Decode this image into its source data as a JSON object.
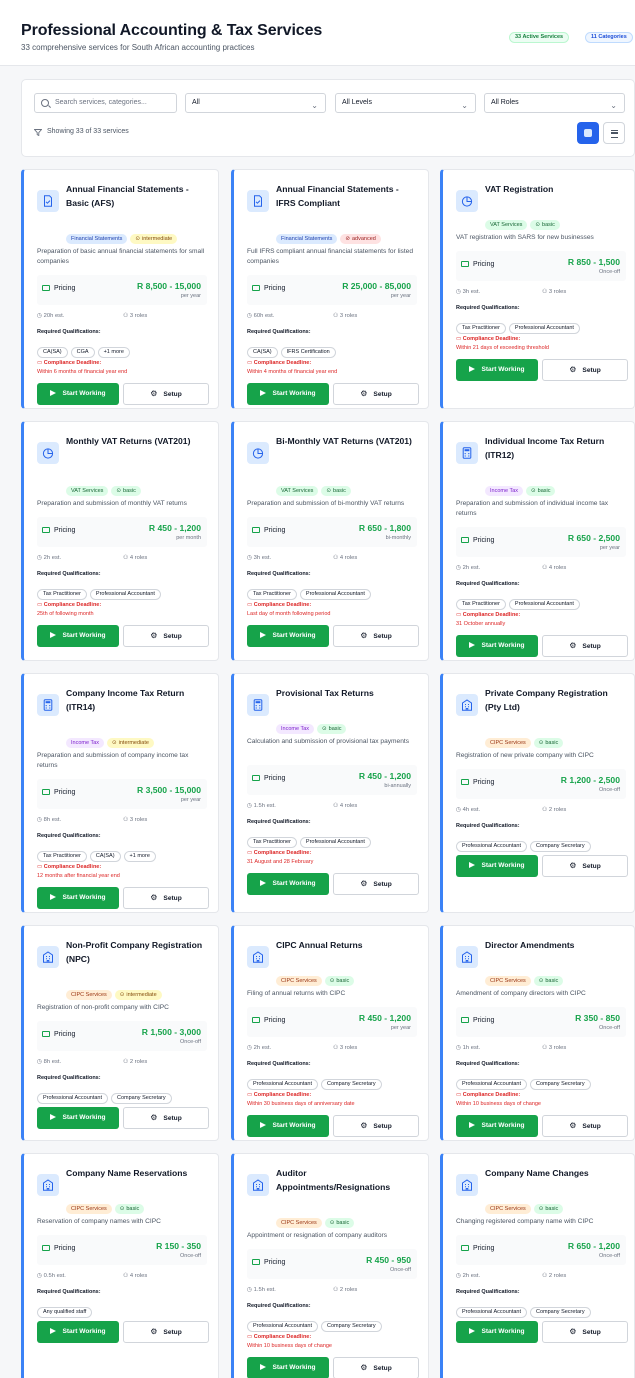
{
  "header": {
    "title": "Professional Accounting & Tax Services",
    "subtitle": "33 comprehensive services for South African accounting practices",
    "active_badge": "33 Active Services",
    "categories_badge": "11 Categories"
  },
  "filters": {
    "search_placeholder": "Search services, categories...",
    "category_value": "All",
    "level_value": "All Levels",
    "role_value": "All Roles",
    "showing": "Showing 33 of 33 services"
  },
  "labels": {
    "pricing": "Pricing",
    "required_qualifications": "Required Qualifications:",
    "compliance_deadline": "Compliance Deadline:",
    "start_working": "Start Working",
    "setup": "Setup"
  },
  "services": [
    {
      "title": "Annual Financial Statements - Basic (AFS)",
      "category": "Financial Statements",
      "level": "intermediate",
      "description": "Preparation of basic annual financial statements for small companies",
      "price": "R 8,500 - 15,000",
      "period": "per year",
      "est": "20h est.",
      "roles": "3 roles",
      "qualifications": [
        "CA(SA)",
        "CGA",
        "+1 more"
      ],
      "deadline": "Within 6 months of financial year end",
      "icon": "document-icon"
    },
    {
      "title": "Annual Financial Statements - IFRS Compliant",
      "category": "Financial Statements",
      "level": "advanced",
      "description": "Full IFRS compliant annual financial statements for listed companies",
      "price": "R 25,000 - 85,000",
      "period": "per year",
      "est": "60h est.",
      "roles": "3 roles",
      "qualifications": [
        "CA(SA)",
        "IFRS Certification"
      ],
      "deadline": "Within 4 months of financial year end",
      "icon": "document-icon"
    },
    {
      "title": "VAT Registration",
      "category": "VAT Services",
      "level": "basic",
      "description": "VAT registration with SARS for new businesses",
      "price": "R 850 - 1,500",
      "period": "Once-off",
      "est": "3h est.",
      "roles": "3 roles",
      "qualifications": [
        "Tax Practitioner",
        "Professional Accountant"
      ],
      "deadline": "Within 21 days of exceeding threshold",
      "icon": "pie-chart-icon"
    },
    {
      "title": "Monthly VAT Returns (VAT201)",
      "category": "VAT Services",
      "level": "basic",
      "description": "Preparation and submission of monthly VAT returns",
      "price": "R 450 - 1,200",
      "period": "per month",
      "est": "2h est.",
      "roles": "4 roles",
      "qualifications": [
        "Tax Practitioner",
        "Professional Accountant"
      ],
      "deadline": "25th of following month",
      "icon": "pie-chart-icon"
    },
    {
      "title": "Bi-Monthly VAT Returns (VAT201)",
      "category": "VAT Services",
      "level": "basic",
      "description": "Preparation and submission of bi-monthly VAT returns",
      "price": "R 650 - 1,800",
      "period": "bi-monthly",
      "est": "3h est.",
      "roles": "4 roles",
      "qualifications": [
        "Tax Practitioner",
        "Professional Accountant"
      ],
      "deadline": "Last day of month following period",
      "icon": "pie-chart-icon"
    },
    {
      "title": "Individual Income Tax Return (ITR12)",
      "category": "Income Tax",
      "level": "basic",
      "description": "Preparation and submission of individual income tax returns",
      "price": "R 650 - 2,500",
      "period": "per year",
      "est": "2h est.",
      "roles": "4 roles",
      "qualifications": [
        "Tax Practitioner",
        "Professional Accountant"
      ],
      "deadline": "31 October annually",
      "icon": "calculator-icon"
    },
    {
      "title": "Company Income Tax Return (ITR14)",
      "category": "Income Tax",
      "level": "intermediate",
      "description": "Preparation and submission of company income tax returns",
      "price": "R 3,500 - 15,000",
      "period": "per year",
      "est": "8h est.",
      "roles": "3 roles",
      "qualifications": [
        "Tax Practitioner",
        "CA(SA)",
        "+1 more"
      ],
      "deadline": "12 months after financial year end",
      "icon": "calculator-icon"
    },
    {
      "title": "Provisional Tax Returns",
      "category": "Income Tax",
      "level": "basic",
      "description": "Calculation and submission of provisional tax payments",
      "price": "R 450 - 1,200",
      "period": "bi-annually",
      "est": "1.5h est.",
      "roles": "4 roles",
      "qualifications": [
        "Tax Practitioner",
        "Professional Accountant"
      ],
      "deadline": "31 August and 28 February",
      "icon": "calculator-icon"
    },
    {
      "title": "Private Company Registration (Pty Ltd)",
      "category": "CIPC Services",
      "level": "basic",
      "description": "Registration of new private company with CIPC",
      "price": "R 1,200 - 2,500",
      "period": "Once-off",
      "est": "4h est.",
      "roles": "2 roles",
      "qualifications": [
        "Professional Accountant",
        "Company Secretary"
      ],
      "deadline": "",
      "icon": "building-icon"
    },
    {
      "title": "Non-Profit Company Registration (NPC)",
      "category": "CIPC Services",
      "level": "intermediate",
      "description": "Registration of non-profit company with CIPC",
      "price": "R 1,500 - 3,000",
      "period": "Once-off",
      "est": "8h est.",
      "roles": "2 roles",
      "qualifications": [
        "Professional Accountant",
        "Company Secretary"
      ],
      "deadline": "",
      "icon": "building-icon"
    },
    {
      "title": "CIPC Annual Returns",
      "category": "CIPC Services",
      "level": "basic",
      "description": "Filing of annual returns with CIPC",
      "price": "R 450 - 1,200",
      "period": "per year",
      "est": "2h est.",
      "roles": "3 roles",
      "qualifications": [
        "Professional Accountant",
        "Company Secretary"
      ],
      "deadline": "Within 30 business days of anniversary date",
      "icon": "building-icon"
    },
    {
      "title": "Director Amendments",
      "category": "CIPC Services",
      "level": "basic",
      "description": "Amendment of company directors with CIPC",
      "price": "R 350 - 850",
      "period": "Once-off",
      "est": "1h est.",
      "roles": "3 roles",
      "qualifications": [
        "Professional Accountant",
        "Company Secretary"
      ],
      "deadline": "Within 10 business days of change",
      "icon": "building-icon"
    },
    {
      "title": "Company Name Reservations",
      "category": "CIPC Services",
      "level": "basic",
      "description": "Reservation of company names with CIPC",
      "price": "R 150 - 350",
      "period": "Once-off",
      "est": "0.5h est.",
      "roles": "4 roles",
      "qualifications": [
        "Any qualified staff"
      ],
      "deadline": "",
      "icon": "building-icon"
    },
    {
      "title": "Auditor Appointments/Resignations",
      "category": "CIPC Services",
      "level": "basic",
      "description": "Appointment or resignation of company auditors",
      "price": "R 450 - 950",
      "period": "Once-off",
      "est": "1.5h est.",
      "roles": "2 roles",
      "qualifications": [
        "Professional Accountant",
        "Company Secretary"
      ],
      "deadline": "Within 10 business days of change",
      "icon": "building-icon"
    },
    {
      "title": "Company Name Changes",
      "category": "CIPC Services",
      "level": "basic",
      "description": "Changing registered company name with CIPC",
      "price": "R 650 - 1,200",
      "period": "Once-off",
      "est": "2h est.",
      "roles": "2 roles",
      "qualifications": [
        "Professional Accountant",
        "Company Secretary"
      ],
      "deadline": "",
      "icon": "building-icon"
    }
  ],
  "colors": {
    "accent": "#2563eb",
    "card_border": "#3b82f6",
    "price": "#16a34a",
    "start_button": "#16a34a",
    "deadline": "#dc2626"
  }
}
